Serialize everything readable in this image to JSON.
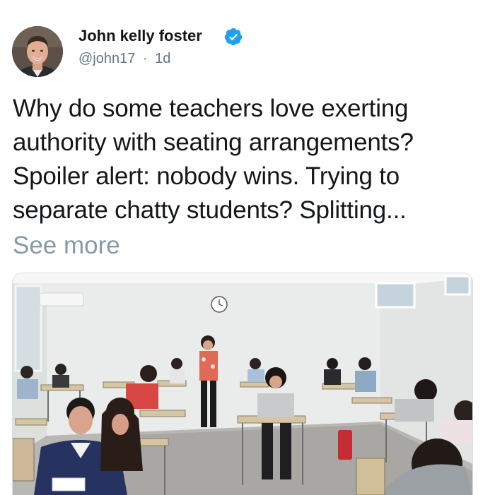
{
  "tweet": {
    "author_name": "John kelly foster",
    "handle": "@john17",
    "separator": "·",
    "time_ago": "1d",
    "verified": true,
    "text_lines": [
      "Why do some teachers love exerting",
      "authority with seating arrangements?",
      "Spoiler alert: nobody wins. Trying to",
      "separate chatty students? Splitting..."
    ],
    "see_more_label": "See more"
  },
  "icons": {
    "verified": "verified-badge-icon",
    "avatar": "profile-photo"
  },
  "colors": {
    "verified_blue": "#1da1f2",
    "text_primary": "#14171a",
    "text_secondary": "#657786",
    "see_more": "#8899a6"
  }
}
